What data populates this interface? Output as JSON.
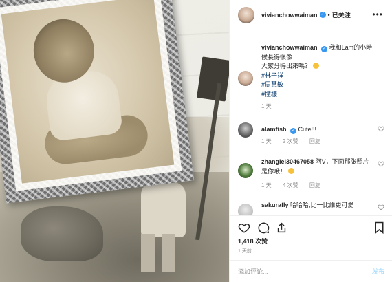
{
  "post": {
    "photo": {
      "alt": ""
    },
    "header": {
      "username": "vivianchowwaiman",
      "follow_separator": "•",
      "follow_label": "已关注",
      "more_icon": "more-horizontal-icon"
    },
    "caption": {
      "username": "vivianchowwaiman",
      "lines": [
        "我和Lam的小時候長得很像",
        "大家分得出來嗎？"
      ],
      "tags": [
        "#林子祥",
        "#周慧敏",
        "#撞樣"
      ],
      "time": "1 天"
    },
    "comments": [
      {
        "username": "alamfish",
        "text": "Cute!!!",
        "time": "1 天",
        "likes": "2 次赞",
        "reply": "回复"
      },
      {
        "username": "zhanglei30467058",
        "text": "阿V，下面那张照片是你哦！",
        "time": "1 天",
        "likes": "4 次赞",
        "reply": "回复"
      },
      {
        "username": "sakurafly",
        "text": "哈哈哈,比一比誰更可愛",
        "time": "",
        "likes": "",
        "reply": ""
      }
    ],
    "actions": {
      "like_icon": "heart-icon",
      "comment_icon": "comment-icon",
      "share_icon": "share-icon",
      "save_icon": "bookmark-icon"
    },
    "likes_label": "1,418 次赞",
    "timestamp": "1 天前",
    "add_comment": {
      "placeholder": "添加评论...",
      "post_label": "发布"
    }
  }
}
